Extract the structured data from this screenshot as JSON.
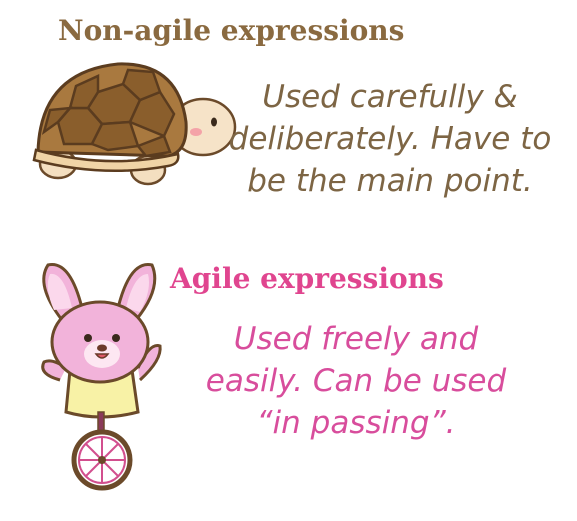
{
  "non_agile": {
    "heading": "Non-agile expressions",
    "description_lines": [
      "Used carefully &",
      "deliberately. Have to",
      "be the main point."
    ],
    "color": "#8a6a40"
  },
  "agile": {
    "heading": "Agile expressions",
    "description_lines": [
      "Used freely and",
      "easily. Can be used",
      "“in passing”."
    ],
    "color": "#e0458f"
  },
  "icons": [
    "turtle-illustration",
    "bunny-unicycle-illustration"
  ]
}
